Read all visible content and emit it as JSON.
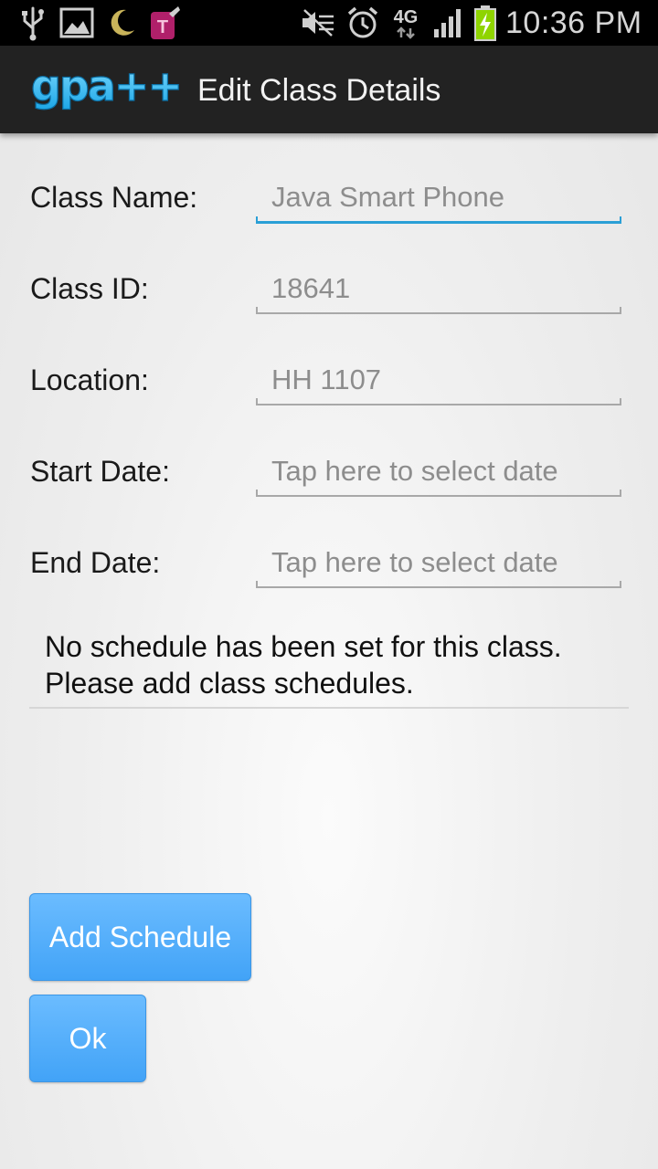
{
  "status_bar": {
    "time": "10:36 PM",
    "network_type": "4G",
    "carrier_badge": "T",
    "icons": [
      "usb-icon",
      "picture-icon",
      "moon-icon",
      "tmobile-icon",
      "mute-icon",
      "alarm-icon",
      "network-4g-icon",
      "signal-icon",
      "battery-charging-icon"
    ]
  },
  "action_bar": {
    "logo_text": "gpa++",
    "title": "Edit Class Details"
  },
  "form": {
    "fields": [
      {
        "label": "Class Name:",
        "value": "Java Smart Phone",
        "focused": true
      },
      {
        "label": "Class ID:",
        "value": "18641"
      },
      {
        "label": "Location:",
        "value": "HH 1107"
      },
      {
        "label": "Start Date:",
        "placeholder": "Tap here to select date"
      },
      {
        "label": "End Date:",
        "placeholder": "Tap here to select date"
      }
    ]
  },
  "schedule": {
    "line1": "No schedule has been set for this class.",
    "line2": "Please add class schedules."
  },
  "buttons": {
    "add_schedule": "Add Schedule",
    "ok": "Ok"
  },
  "colors": {
    "accent_focus": "#2a9fd6",
    "button_blue": "#42a3f7",
    "action_bar": "#222222",
    "battery_green": "#8fd400"
  }
}
